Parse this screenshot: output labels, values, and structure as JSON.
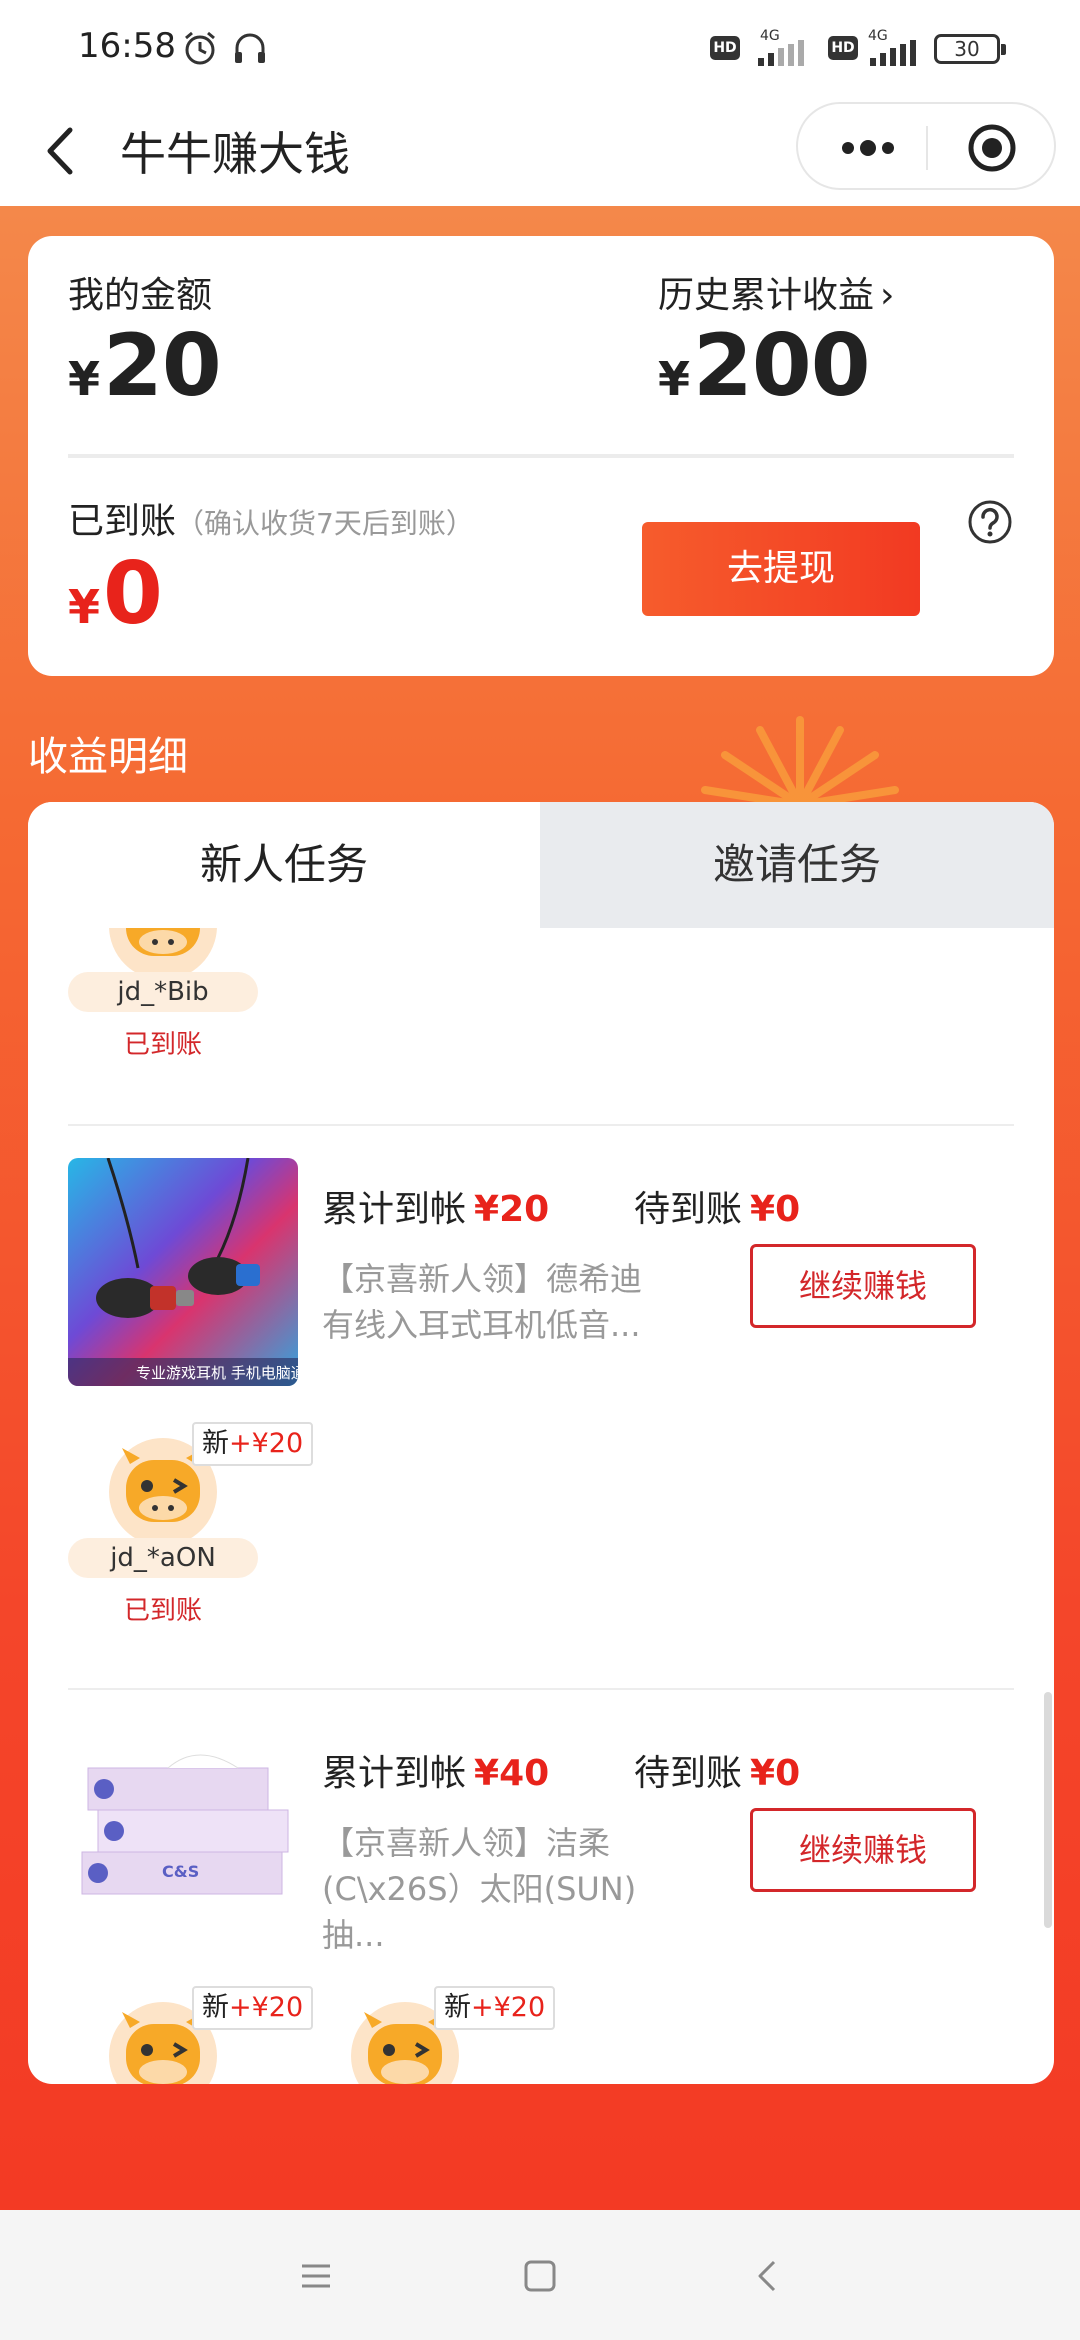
{
  "status_bar": {
    "time": "16:58",
    "icons": [
      "alarm-icon",
      "headset-icon",
      "hd-icon",
      "signal-4g-icon",
      "hd-icon",
      "signal-4g-icon",
      "battery-icon"
    ],
    "hd_label": "HD",
    "net_label": "4G",
    "battery": "30"
  },
  "nav": {
    "title": "牛牛赚大钱",
    "back_icon": "chevron-left-icon",
    "more_icon": "more-dots-icon",
    "target_icon": "target-icon"
  },
  "balance": {
    "my_amount_label": "我的金额",
    "my_amount": "20",
    "history_label": "历史累计收益",
    "history_arrow": "›",
    "history_amount": "200",
    "arrived_label": "已到账",
    "arrived_hint": "（确认收货7天后到账）",
    "arrived_amount": "0",
    "currency": "¥",
    "withdraw_label": "去提现",
    "help_icon": "question-circle-icon"
  },
  "section_title": "收益明细",
  "tabs": [
    {
      "label": "新人任务",
      "active": true
    },
    {
      "label": "邀请任务",
      "active": false
    }
  ],
  "rows": [
    {
      "users": [
        {
          "name": "jd_*Bib",
          "status": "已到账"
        }
      ]
    },
    {
      "cumulative_label": "累计到帐",
      "cumulative_value": "¥20",
      "pending_label": "待到账",
      "pending_value": "¥0",
      "title": "【京喜新人领】德希迪有线入耳式耳机低音...",
      "image_caption": "专业游戏耳机 手机电脑通用",
      "button": "继续赚钱",
      "users": [
        {
          "name": "jd_*aON",
          "status": "已到账",
          "tag_prefix": "新",
          "tag_value": "+¥20"
        }
      ]
    },
    {
      "cumulative_label": "累计到帐",
      "cumulative_value": "¥40",
      "pending_label": "待到账",
      "pending_value": "¥0",
      "title": "【京喜新人领】洁柔(C\\x26S）太阳(SUN)抽...",
      "image_brand": "C&S",
      "button": "继续赚钱",
      "users": [
        {
          "tag_prefix": "新",
          "tag_value": "+¥20"
        },
        {
          "tag_prefix": "新",
          "tag_value": "+¥20"
        }
      ]
    }
  ],
  "colors": {
    "accent_red": "#e8231b",
    "orange_bg_top": "#f4884a",
    "orange_bg_bottom": "#f33a24",
    "pill_bg": "#fdeede"
  },
  "system_nav": [
    "menu-icon",
    "home-square-icon",
    "back-triangle-icon"
  ]
}
